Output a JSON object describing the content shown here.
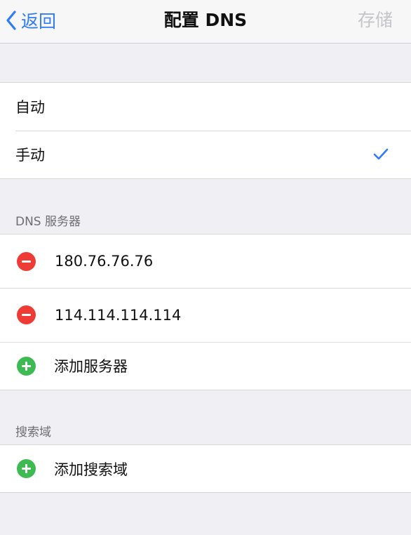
{
  "navbar": {
    "back_label": "返回",
    "title": "配置 DNS",
    "save_label": "存储"
  },
  "mode": {
    "options": [
      {
        "label": "自动",
        "selected": false
      },
      {
        "label": "手动",
        "selected": true
      }
    ]
  },
  "dns_servers": {
    "header": "DNS 服务器",
    "entries": [
      "180.76.76.76",
      "114.114.114.114"
    ],
    "add_label": "添加服务器"
  },
  "search_domains": {
    "header": "搜索域",
    "add_label": "添加搜索域"
  },
  "colors": {
    "accent": "#2f7cf6",
    "delete": "#ee3b35",
    "add": "#3dbb52",
    "disabled": "#c5c5c9",
    "background": "#efeff4"
  }
}
